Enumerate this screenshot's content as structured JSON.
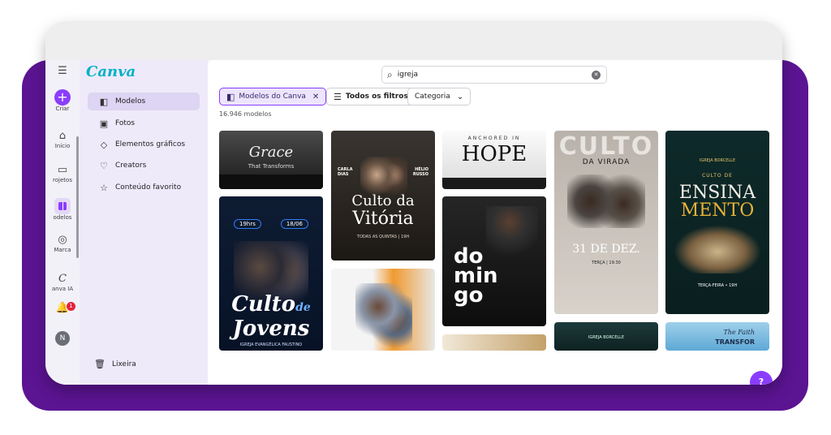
{
  "rail": {
    "toggle_icon": "sidebar-toggle-icon",
    "items": [
      {
        "label": "Criar",
        "icon": "plus-icon"
      },
      {
        "label": "Início",
        "icon": "home-icon"
      },
      {
        "label": "rojetos",
        "icon": "folder-icon"
      },
      {
        "label": "odelos",
        "icon": "templates-icon"
      },
      {
        "label": "Marca",
        "icon": "brand-icon"
      },
      {
        "label": "anva IA",
        "icon": "canva-ai-icon"
      }
    ],
    "notification_count": "1",
    "avatar_initial": "N"
  },
  "nav": {
    "logo": "Canva",
    "items": [
      {
        "label": "Modelos",
        "icon": "templates-icon"
      },
      {
        "label": "Fotos",
        "icon": "photo-icon"
      },
      {
        "label": "Elementos gráficos",
        "icon": "shapes-icon"
      },
      {
        "label": "Creators",
        "icon": "creators-icon"
      },
      {
        "label": "Conteúdo favorito",
        "icon": "star-icon"
      }
    ],
    "trash_label": "Lixeira"
  },
  "search": {
    "value": "igreja"
  },
  "filters": {
    "canva_templates": "Modelos do Canva",
    "all_filters": "Todos os filtros",
    "category": "Categoria"
  },
  "result_count": "16.946 modelos",
  "templates": {
    "t1": {
      "title": "Grace",
      "subtitle": "That Transforms"
    },
    "t2": {
      "name1": "CARLA DIAS",
      "name2": "HÉLIO RUSSO",
      "title1": "Culto da",
      "title2": "Vitória",
      "caption": "TODAS AS QUINTAS | 19H"
    },
    "t3": {
      "top": "ANCHORED IN",
      "title": "HOPE"
    },
    "t4": {
      "top": "CULTO",
      "sub": "DA VIRADA",
      "date": "31 DE DEZ.",
      "day": "TERÇA | 19:30"
    },
    "t5": {
      "org": "IGREJA BORCELLE",
      "tag": "CULTO DE",
      "title1": "ENSINA",
      "title2": "MENTO",
      "caption": "TERÇA-FEIRA • 19H"
    },
    "t6": {
      "time": "19hrs",
      "date": "18/06",
      "title1": "Culto",
      "title2": "de",
      "title3": "Jovens",
      "caption": "IGREJA EVANGÉLICA FAUSTINO"
    },
    "t7": {
      "title1": "do",
      "title2": "min",
      "title3": "go"
    },
    "t8": {
      "org": "IGREJA BORCELLE"
    },
    "t9": {
      "title": "The Faith",
      "sub": "TRANSFOR"
    }
  },
  "help_label": "?",
  "colors": {
    "accent": "#8b3dff",
    "backdrop": "#5b1492",
    "logo": "#00b1c6"
  }
}
